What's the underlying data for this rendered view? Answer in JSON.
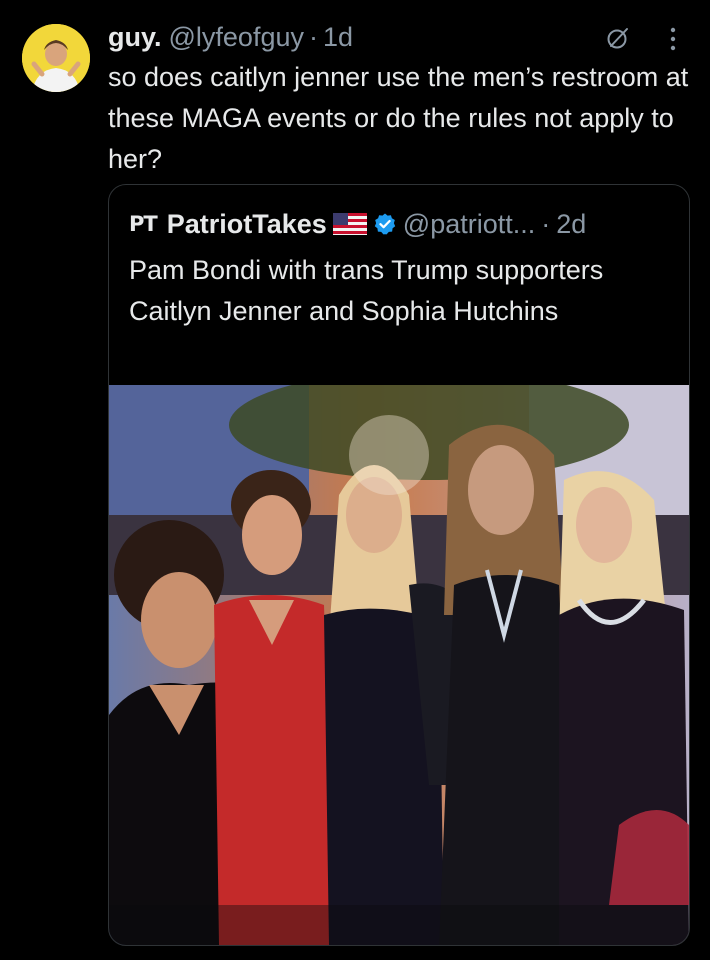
{
  "tweet": {
    "display_name": "guy.",
    "handle": "@lyfeofguy",
    "separator": "·",
    "time": "1d",
    "text": "so does caitlyn jenner use the men’s restroom at these MAGA events or do the rules not apply to her?",
    "avatar_bg": "#f2d73a",
    "icons": [
      "grok-icon",
      "more-icon"
    ]
  },
  "quote": {
    "logo_text": "PT",
    "display_name": "PatriotTakes",
    "flag_icon": "us-flag-icon",
    "verified_icon": "verified-icon",
    "verified_color": "#1d9bf0",
    "handle": "@patriott...",
    "separator": "·",
    "time": "2d",
    "text": "Pam Bondi with trans Trump supporters Caitlyn Jenner and Sophia Hutchins"
  },
  "colors": {
    "background": "#000000",
    "primary_text": "#e7e9ea",
    "secondary_text": "#8b98a5",
    "border": "#2f3336"
  }
}
